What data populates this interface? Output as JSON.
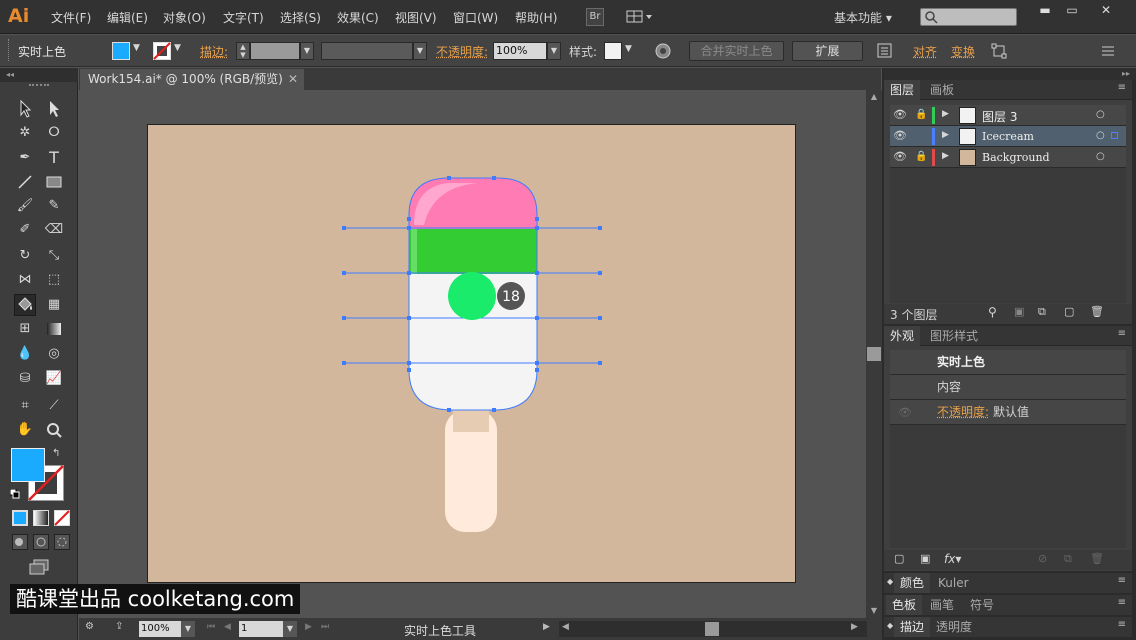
{
  "app": {
    "logo": "Ai",
    "workspace": "基本功能"
  },
  "menu": [
    "文件(F)",
    "编辑(E)",
    "对象(O)",
    "文字(T)",
    "选择(S)",
    "效果(C)",
    "视图(V)",
    "窗口(W)",
    "帮助(H)"
  ],
  "menubar_buttons": {
    "bridge": "Br"
  },
  "control": {
    "tool_label": "实时上色",
    "stroke_label": "描边:",
    "opacity_label": "不透明度:",
    "opacity_value": "100%",
    "style_label": "样式:",
    "merge_button": "合并实时上色",
    "expand_button": "扩展",
    "align_label": "对齐",
    "transform_label": "变换"
  },
  "document": {
    "tab_title": "Work154.ai* @ 100% (RGB/预览)"
  },
  "canvas": {
    "badge_number": "18"
  },
  "status": {
    "zoom": "100%",
    "page": "1",
    "tool": "实时上色工具"
  },
  "layers_panel": {
    "tabs": [
      "图层",
      "画板"
    ],
    "layers": [
      {
        "name": "图层 3",
        "color": "#33cc55",
        "thumb": "#f2f2f2"
      },
      {
        "name": "Icecream",
        "color": "#4a7fff",
        "thumb": "#f2f2f2"
      },
      {
        "name": "Background",
        "color": "#e04a4a",
        "thumb": "#d3b79c"
      }
    ],
    "count": "3 个图层"
  },
  "appearance_panel": {
    "tabs": [
      "外观",
      "图形样式"
    ],
    "title": "实时上色",
    "content": "内容",
    "opacity_label": "不透明度:",
    "opacity_value": "默认值"
  },
  "collapsed_panels": [
    {
      "tabs": [
        "颜色",
        "Kuler"
      ]
    },
    {
      "tabs": [
        "色板",
        "画笔",
        "符号"
      ]
    },
    {
      "tabs": [
        "描边",
        "透明度"
      ]
    }
  ],
  "watermark": "酷课堂出品 coolketang.com",
  "colors": {
    "fill": "#1aabff",
    "artboard": "#d3b79c",
    "ice_pink": "#ff7bb4",
    "ice_green": "#33cc33",
    "ice_white": "#f4f4f4",
    "stick": "#ffeadb",
    "live_paint_cursor": "#1aeb6a",
    "selection": "#3d7bff"
  }
}
